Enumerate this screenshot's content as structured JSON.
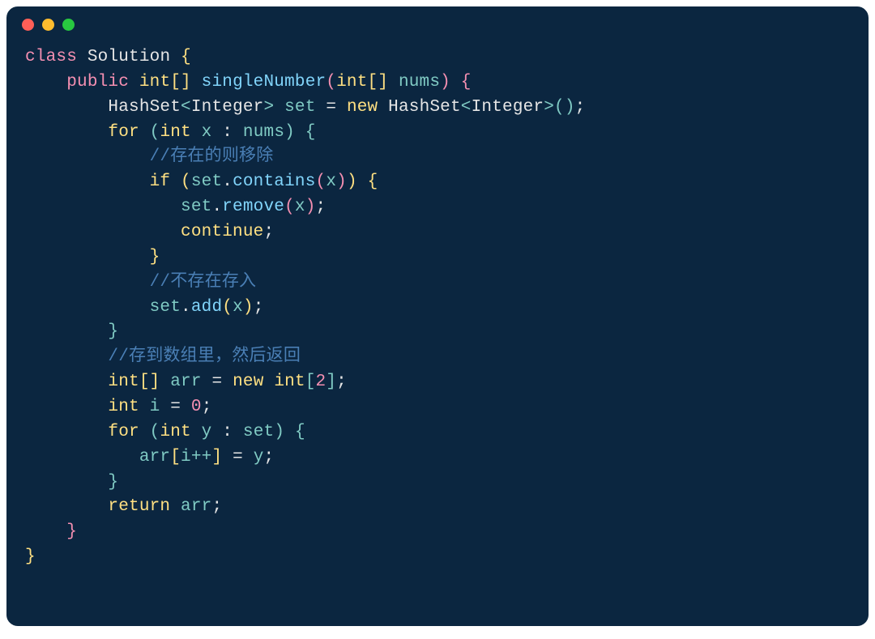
{
  "language": "Java",
  "tokens": {
    "class": "class",
    "Solution": "Solution",
    "public": "public",
    "int_arr": "int[]",
    "singleNumber": "singleNumber",
    "nums": "nums",
    "HashSet": "HashSet",
    "Integer": "Integer",
    "set": "set",
    "new": "new",
    "for": "for",
    "int": "int",
    "x": "x",
    "comment1": "//存在的则移除",
    "if": "if",
    "contains": "contains",
    "remove": "remove",
    "continue": "continue",
    "comment2": "//不存在存入",
    "add": "add",
    "comment3": "//存到数组里，然后返回",
    "arr": "arr",
    "two": "2",
    "i": "i",
    "zero": "0",
    "y": "y",
    "iplus": "i++",
    "return": "return"
  }
}
